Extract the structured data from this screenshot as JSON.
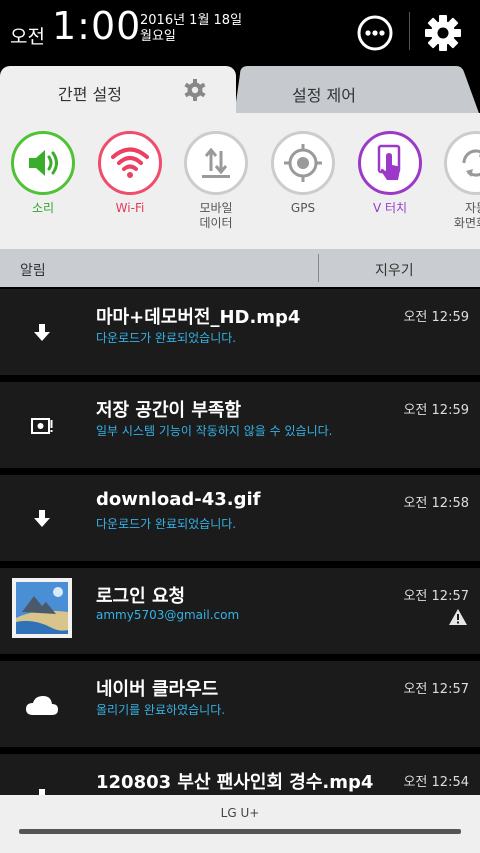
{
  "status": {
    "ampm": "오전",
    "time": "1:00",
    "date_line1": "2016년 1월 18일",
    "date_line2": "월요일"
  },
  "tabs": {
    "quick_settings": "간편 설정",
    "settings_control": "설정 제어"
  },
  "quick_settings": [
    {
      "label": "소리",
      "icon": "volume-icon",
      "active": true,
      "color": "#33b233"
    },
    {
      "label": "Wi-Fi",
      "icon": "wifi-icon",
      "active": true,
      "color": "#ef4d6b"
    },
    {
      "label": "모바일\n데이터",
      "icon": "mobile-data-icon",
      "active": false,
      "color": "#8a8a8a"
    },
    {
      "label": "GPS",
      "icon": "gps-icon",
      "active": false,
      "color": "#8a8a8a"
    },
    {
      "label": "V 터치",
      "icon": "v-touch-icon",
      "active": true,
      "color": "#9b39c9"
    },
    {
      "label": "자동\n화면회전",
      "icon": "auto-rotate-icon",
      "active": false,
      "color": "#8a8a8a"
    }
  ],
  "notif_header": {
    "title": "알림",
    "clear": "지우기"
  },
  "notifications": [
    {
      "icon": "download-icon",
      "title": "마마+데모버전_HD.mp4",
      "subtitle": "다운로드가 완료되었습니다.",
      "time": "오전 12:59"
    },
    {
      "icon": "storage-icon",
      "title": "저장 공간이 부족함",
      "subtitle": "일부 시스템 기능이 작동하지 않을 수 있습니다.",
      "time": "오전 12:59"
    },
    {
      "icon": "download-icon",
      "title": "download-43.gif",
      "subtitle": "다운로드가 완료되었습니다.",
      "time": "오전 12:58"
    },
    {
      "icon": "landscape-thumbnail-icon",
      "title": "로그인 요청",
      "subtitle": "ammy5703@gmail.com",
      "time": "오전 12:57",
      "warning": true
    },
    {
      "icon": "cloud-icon",
      "title": "네이버 클라우드",
      "subtitle": "올리기를 완료하였습니다.",
      "time": "오전 12:57"
    },
    {
      "icon": "download-icon",
      "title": "120803  부산 팬사인회 경수.mp4",
      "subtitle": "",
      "time": "오전 12:54"
    }
  ],
  "bottom": {
    "carrier": "LG U+"
  }
}
